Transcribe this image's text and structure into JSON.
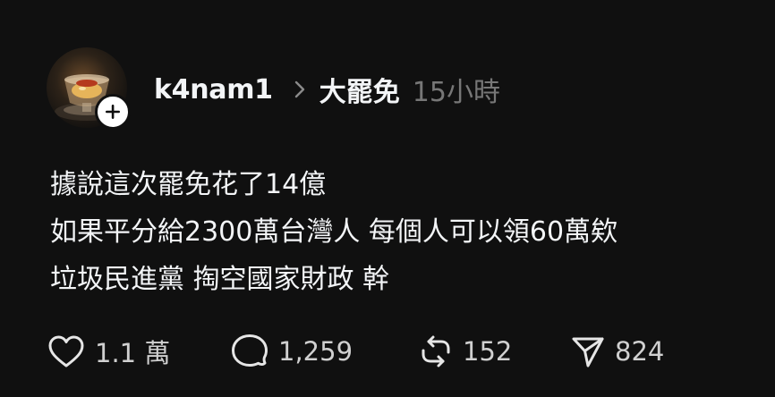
{
  "post": {
    "author": {
      "username": "k4nam1",
      "avatar_icon": "avatar-photo"
    },
    "community": "大罷免",
    "timestamp": "15小時",
    "body_lines": [
      "據說這次罷免花了14億",
      "如果平分給2300萬台灣人 每個人可以領60萬欸",
      "垃圾民進黨 掏空國家財政 幹"
    ],
    "actions": {
      "likes": "1.1 萬",
      "replies": "1,259",
      "reposts": "152",
      "shares": "824"
    }
  },
  "colors": {
    "background": "#101010",
    "text_primary": "#f3f5f7",
    "text_secondary": "#777777"
  }
}
